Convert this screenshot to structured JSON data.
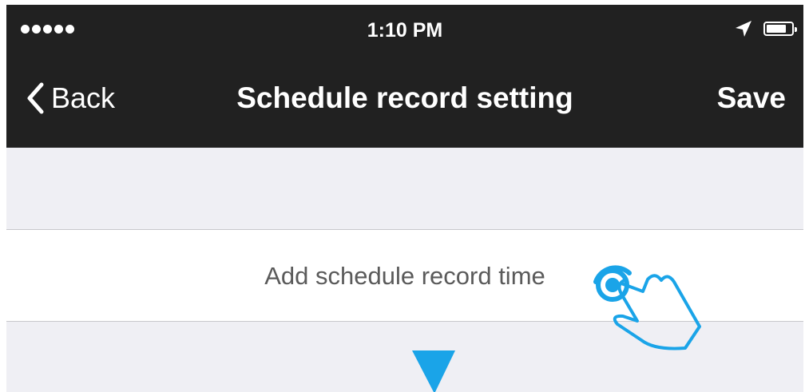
{
  "status_bar": {
    "signal_icon": "signal-dots-icon",
    "time": "1:10 PM",
    "location_icon": "location-arrow-icon",
    "battery_icon": "battery-icon"
  },
  "nav_bar": {
    "back_icon": "chevron-left-icon",
    "back_label": "Back",
    "title": "Schedule record setting",
    "save_label": "Save"
  },
  "content": {
    "add_schedule_label": "Add schedule record time"
  },
  "overlay": {
    "tap_hand_icon": "tap-hand-icon",
    "down_arrow_icon": "down-arrow-icon"
  },
  "colors": {
    "nav_background": "#212121",
    "page_background": "#efeff4",
    "accent": "#1aa4e8"
  }
}
